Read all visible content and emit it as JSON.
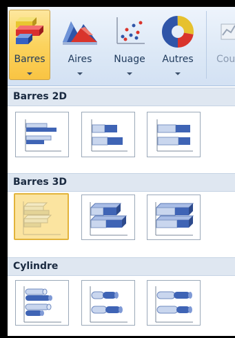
{
  "ribbon": {
    "buttons": [
      {
        "label": "Barres",
        "icon": "bar-chart-icon",
        "selected": true
      },
      {
        "label": "Aires",
        "icon": "area-chart-icon"
      },
      {
        "label": "Nuage",
        "icon": "scatter-chart-icon"
      },
      {
        "label": "Autres",
        "icon": "donut-chart-icon"
      },
      {
        "label": "Cou",
        "icon": "curve-chart-icon"
      }
    ]
  },
  "gallery": {
    "sections": [
      {
        "title": "Barres 2D"
      },
      {
        "title": "Barres 3D"
      },
      {
        "title": "Cylindre"
      }
    ]
  },
  "colors": {
    "bar_blue": "#3f64b5",
    "bar_light": "#c9d6ee",
    "selected_fill": "#fbe4a0",
    "selected_border": "#e2b33a"
  }
}
